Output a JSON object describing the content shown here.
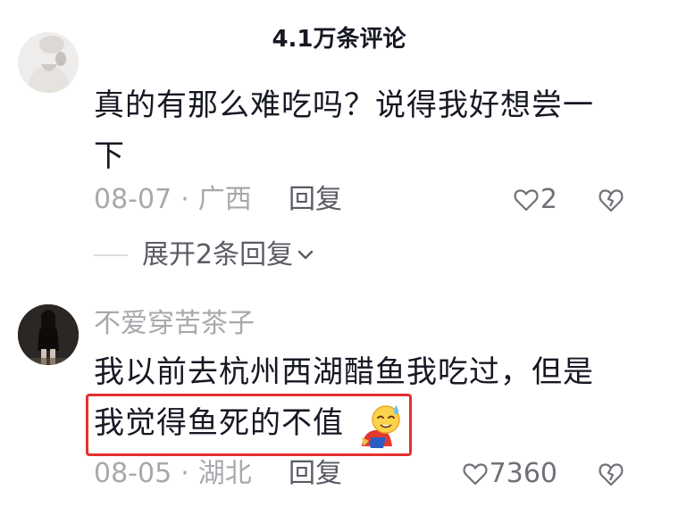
{
  "header": {
    "title": "4.1万条评论"
  },
  "comments": [
    {
      "text_line1": "真的有那么难吃吗？说得我好想尝一",
      "text_line2": "下",
      "date": "08-07",
      "dot": "·",
      "region": "广西",
      "reply_label": "回复",
      "likes": "2",
      "expand_label": "展开2条回复"
    },
    {
      "username": "不爱穿苦茶子",
      "text_line1": "我以前去杭州西湖醋鱼我吃过，但是",
      "text_line2": "我觉得鱼死的不值",
      "date": "08-05",
      "dot": "·",
      "region": "湖北",
      "reply_label": "回复",
      "likes": "7360"
    }
  ],
  "icons": {
    "like": "heart-outline-icon",
    "dislike": "broken-heart-icon",
    "expand": "chevron-down-icon",
    "emoji": "bowing-sweat-emoji"
  },
  "colors": {
    "text_primary": "#161823",
    "text_secondary": "#a8a8ad",
    "highlight_border": "#e5312f"
  }
}
